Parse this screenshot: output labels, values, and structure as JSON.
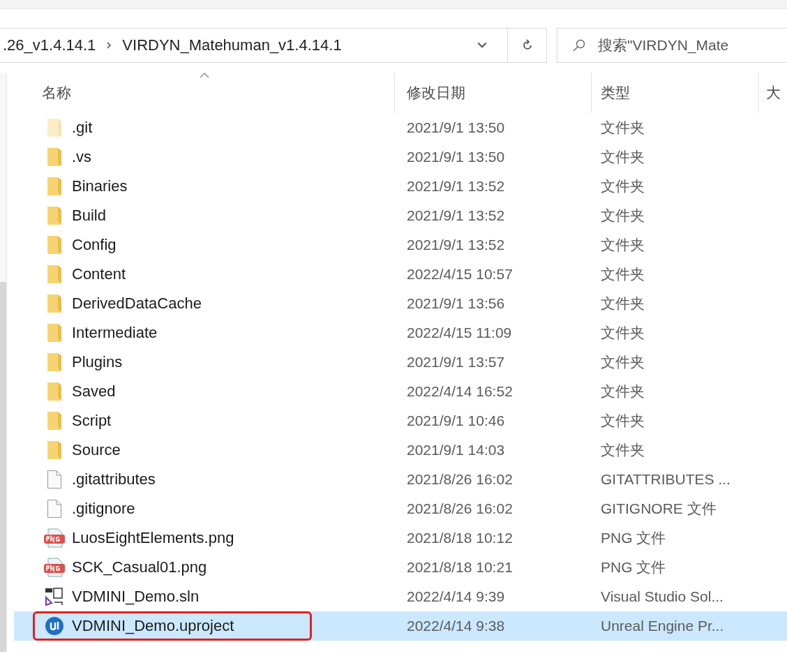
{
  "address_bar": {
    "path": [
      ".26_v1.4.14.1",
      "VIRDYN_Matehuman_v1.4.14.1"
    ]
  },
  "search": {
    "placeholder": "搜索\"VIRDYN_Mate"
  },
  "columns": [
    {
      "label": "名称",
      "sorted": true
    },
    {
      "label": "修改日期",
      "sorted": false
    },
    {
      "label": "类型",
      "sorted": false
    },
    {
      "label": "大",
      "sorted": false
    }
  ],
  "rows": [
    {
      "name": ".git",
      "date": "2021/9/1 13:50",
      "type": "文件夹",
      "kind": "folder",
      "hidden": true,
      "selected": false,
      "highlighted": false
    },
    {
      "name": ".vs",
      "date": "2021/9/1 13:50",
      "type": "文件夹",
      "kind": "folder",
      "hidden": false,
      "selected": false,
      "highlighted": false
    },
    {
      "name": "Binaries",
      "date": "2021/9/1 13:52",
      "type": "文件夹",
      "kind": "folder",
      "hidden": false,
      "selected": false,
      "highlighted": false
    },
    {
      "name": "Build",
      "date": "2021/9/1 13:52",
      "type": "文件夹",
      "kind": "folder",
      "hidden": false,
      "selected": false,
      "highlighted": false
    },
    {
      "name": "Config",
      "date": "2021/9/1 13:52",
      "type": "文件夹",
      "kind": "folder",
      "hidden": false,
      "selected": false,
      "highlighted": false
    },
    {
      "name": "Content",
      "date": "2022/4/15 10:57",
      "type": "文件夹",
      "kind": "folder",
      "hidden": false,
      "selected": false,
      "highlighted": false
    },
    {
      "name": "DerivedDataCache",
      "date": "2021/9/1 13:56",
      "type": "文件夹",
      "kind": "folder",
      "hidden": false,
      "selected": false,
      "highlighted": false
    },
    {
      "name": "Intermediate",
      "date": "2022/4/15 11:09",
      "type": "文件夹",
      "kind": "folder",
      "hidden": false,
      "selected": false,
      "highlighted": false
    },
    {
      "name": "Plugins",
      "date": "2021/9/1 13:57",
      "type": "文件夹",
      "kind": "folder",
      "hidden": false,
      "selected": false,
      "highlighted": false
    },
    {
      "name": "Saved",
      "date": "2022/4/14 16:52",
      "type": "文件夹",
      "kind": "folder",
      "hidden": false,
      "selected": false,
      "highlighted": false
    },
    {
      "name": "Script",
      "date": "2021/9/1 10:46",
      "type": "文件夹",
      "kind": "folder",
      "hidden": false,
      "selected": false,
      "highlighted": false
    },
    {
      "name": "Source",
      "date": "2021/9/1 14:03",
      "type": "文件夹",
      "kind": "folder",
      "hidden": false,
      "selected": false,
      "highlighted": false
    },
    {
      "name": ".gitattributes",
      "date": "2021/8/26 16:02",
      "type": "GITATTRIBUTES ...",
      "kind": "file",
      "hidden": false,
      "selected": false,
      "highlighted": false
    },
    {
      "name": ".gitignore",
      "date": "2021/8/26 16:02",
      "type": "GITIGNORE 文件",
      "kind": "file",
      "hidden": false,
      "selected": false,
      "highlighted": false
    },
    {
      "name": "LuosEightElements.png",
      "date": "2021/8/18 10:12",
      "type": "PNG 文件",
      "kind": "image",
      "hidden": false,
      "selected": false,
      "highlighted": false
    },
    {
      "name": "SCK_Casual01.png",
      "date": "2021/8/18 10:21",
      "type": "PNG 文件",
      "kind": "image",
      "hidden": false,
      "selected": false,
      "highlighted": false
    },
    {
      "name": "VDMINI_Demo.sln",
      "date": "2022/4/14 9:39",
      "type": "Visual Studio Sol...",
      "kind": "solution",
      "hidden": false,
      "selected": false,
      "highlighted": false
    },
    {
      "name": "VDMINI_Demo.uproject",
      "date": "2022/4/14 9:38",
      "type": "Unreal Engine Pr...",
      "kind": "project",
      "hidden": false,
      "selected": true,
      "highlighted": true
    }
  ]
}
